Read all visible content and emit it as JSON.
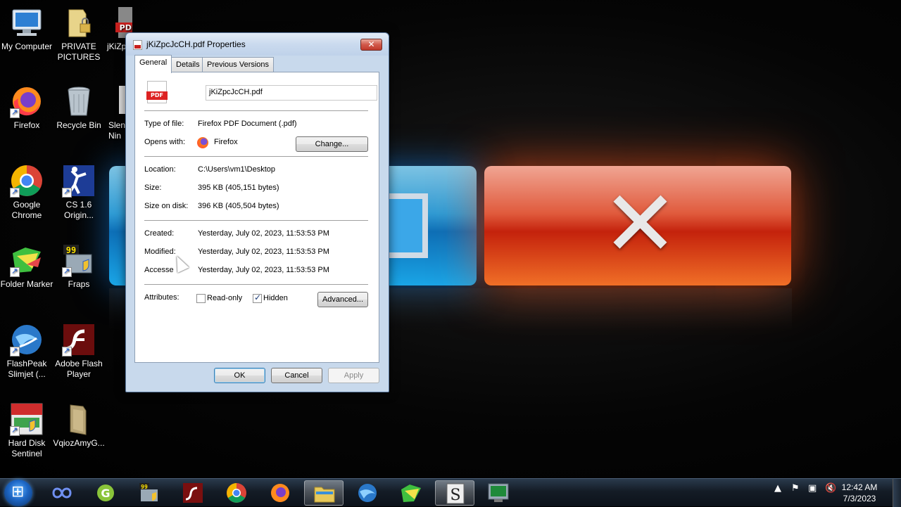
{
  "desktop": {
    "icons": [
      {
        "label": "My Computer",
        "icon": "computer-icon"
      },
      {
        "label": "PRIVATE PICTURES",
        "icon": "locked-folder-icon"
      },
      {
        "label": "jKiZp",
        "icon": "pdf-file-icon"
      },
      {
        "label": "Firefox",
        "icon": "firefox-icon"
      },
      {
        "label": "Recycle Bin",
        "icon": "recycle-bin-icon"
      },
      {
        "label": "Slen Nin",
        "icon": "app-icon"
      },
      {
        "label": "Google Chrome",
        "icon": "chrome-icon"
      },
      {
        "label": "CS 1.6 Origin...",
        "icon": "cs-icon"
      },
      {
        "label": "Folder Marker",
        "icon": "folder-marker-icon"
      },
      {
        "label": "Fraps",
        "icon": "fraps-icon"
      },
      {
        "label": "FlashPeak Slimjet (...",
        "icon": "slimjet-icon"
      },
      {
        "label": "Adobe Flash Player",
        "icon": "flash-icon"
      },
      {
        "label": "Hard Disk Sentinel",
        "icon": "hdd-sentinel-icon"
      },
      {
        "label": "VqiozAmyG...",
        "icon": "folder-icon"
      }
    ]
  },
  "dialog": {
    "title": "jKiZpcJcCH.pdf Properties",
    "close_glyph": "✕",
    "tabs": [
      "General",
      "Details",
      "Previous Versions"
    ],
    "active_tab": "General",
    "file_name": "jKiZpcJcCH.pdf",
    "pdf_badge": "PDF",
    "type_label": "Type of file:",
    "type_value": "Firefox PDF Document (.pdf)",
    "opens_label": "Opens with:",
    "opens_value": "Firefox",
    "change_button": "Change...",
    "location_label": "Location:",
    "location_value": "C:\\Users\\vm1\\Desktop",
    "size_label": "Size:",
    "size_value": "395 KB (405,151 bytes)",
    "size_on_disk_label": "Size on disk:",
    "size_on_disk_value": "396 KB (405,504 bytes)",
    "created_label": "Created:",
    "created_value": "Yesterday, July 02, 2023, 11:53:53 PM",
    "modified_label": "Modified:",
    "modified_value": "Yesterday, July 02, 2023, 11:53:53 PM",
    "accessed_label": "Accesse",
    "accessed_value": "Yesterday, July 02, 2023, 11:53:53 PM",
    "attributes_label": "Attributes:",
    "readonly_label": "Read-only",
    "readonly_checked": false,
    "hidden_label": "Hidden",
    "hidden_checked": true,
    "advanced_button": "Advanced...",
    "ok_button": "OK",
    "cancel_button": "Cancel",
    "apply_button": "Apply"
  },
  "taskbar": {
    "items": [
      "edge-like-icon",
      "garena-icon",
      "fraps-icon",
      "flash-icon",
      "chrome-icon",
      "firefox-icon",
      "file-explorer-icon",
      "slimjet-icon",
      "folder-marker-icon",
      "sentinel-icon",
      "hdd-sentinel-icon"
    ],
    "clock_time": "12:42 AM",
    "clock_date": "7/3/2023"
  }
}
